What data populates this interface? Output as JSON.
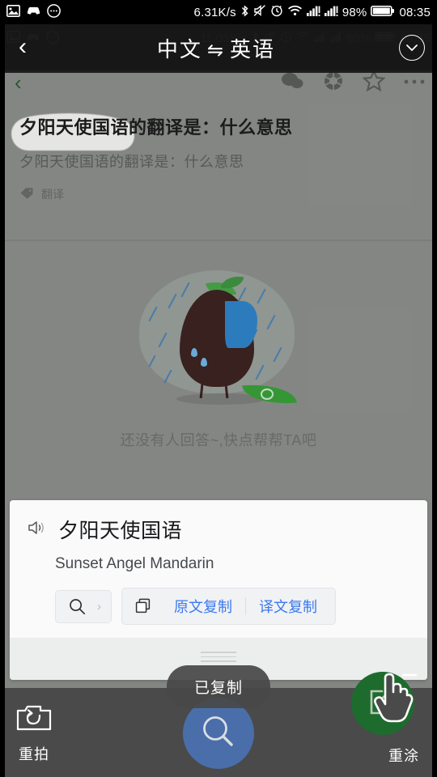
{
  "status_bar": {
    "left_icons": [
      "image-icon",
      "car-icon",
      "chat-bubble-icon"
    ],
    "network_speed": "6.31K/s",
    "icons": [
      "bluetooth-icon",
      "mute-icon",
      "alarm-icon",
      "wifi-icon",
      "signal-1-icon",
      "signal-2-icon"
    ],
    "battery_percent": "98%",
    "clock": "08:35"
  },
  "page_status_bar": {
    "network_speed": "11.03K/s",
    "battery_percent": "99%",
    "clock": "08:35"
  },
  "translate_header": {
    "back_label": "‹",
    "source_language": "中文",
    "swap_symbol": "⇋",
    "target_language": "英语",
    "collapse_label": "⌄"
  },
  "article": {
    "title": "夕阳天使国语的翻译是：什么意思",
    "subtitle": "夕阳天使国语的翻译是：什么意思",
    "tag_icon": "tag-icon",
    "tag_label": "翻译"
  },
  "empty_state": {
    "illustration": "sad-egg-in-rain-illustration",
    "message": "还没有人回答~,快点帮帮TA吧"
  },
  "browser_toolbar": {
    "back_icon": "chevron-left-icon",
    "icons": [
      "comment-icon",
      "refresh-icon",
      "star-icon",
      "more-icon"
    ]
  },
  "translation_card": {
    "speaker_icon": "speaker-icon",
    "source_text": "夕阳天使国语",
    "translated_text": "Sunset Angel Mandarin",
    "search_button": {
      "icon": "search-icon",
      "chevron": "›"
    },
    "copy_group": {
      "icon": "copy-icon",
      "copy_source_label": "原文复制",
      "copy_translation_label": "译文复制",
      "link_color": "#3a79f0"
    },
    "drag_handle": "drag-handle"
  },
  "toast": {
    "message": "已复制"
  },
  "bottom_bar": {
    "retake": {
      "icon": "camera-retake-icon",
      "label": "重拍"
    },
    "search_fab": {
      "icon": "search-icon"
    },
    "repaint": {
      "icon": "edit-square-icon",
      "label": "重涂"
    },
    "cursor": "pointing-hand-cursor"
  },
  "colors": {
    "page_bg": "#8d8f8d",
    "header_bg": "#161616",
    "card_bg": "#fafafa",
    "fab_blue": "#4a6ea9",
    "fab_green": "#1e6b2e",
    "toolbar_bg": "#4a4a4a"
  }
}
